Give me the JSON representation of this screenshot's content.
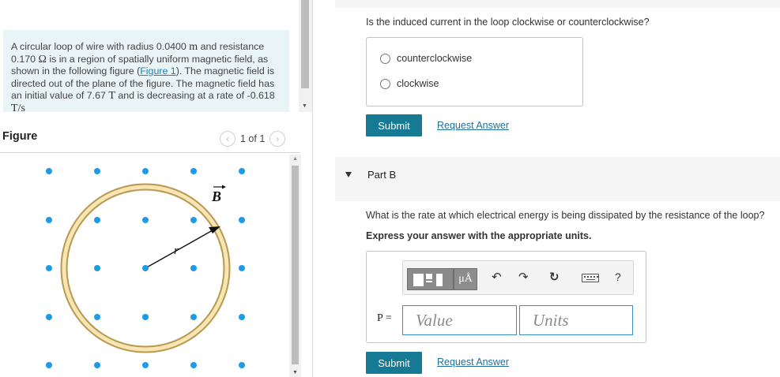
{
  "problem": {
    "text_1": "A circular loop of wire with radius 0.0400",
    "unit_m": "m",
    "text_2": "and resistance 0.170",
    "unit_ohm": "Ω",
    "text_3": "is in a region of spatially uniform magnetic field, as shown in the following figure (",
    "figure_link": "Figure 1",
    "text_4": "). The magnetic field is directed out of the plane of the figure. The magnetic field has an initial value of 7.67",
    "unit_T": "T",
    "text_5": "and is decreasing at a rate of -0.618",
    "unit_Ts": "T/s"
  },
  "figure": {
    "title": "Figure",
    "pager_text": "1 of 1",
    "prev_glyph": "‹",
    "next_glyph": "›",
    "b_label": "B",
    "r_label": "r",
    "colors": {
      "dot": "#1e9be6",
      "ring_outer": "#b99950",
      "ring_fill": "#f7e6b4",
      "arrow": "#111111"
    }
  },
  "part_a": {
    "question": "Is the induced current in the loop clockwise or counterclockwise?",
    "options": [
      "counterclockwise",
      "clockwise"
    ],
    "submit_label": "Submit",
    "request_label": "Request Answer"
  },
  "part_b": {
    "title": "Part B",
    "question": "What is the rate at which electrical energy is being dissipated by the resistance of the loop?",
    "instruction": "Express your answer with the appropriate units.",
    "toolbar": {
      "mu_label": "μÅ",
      "undo_glyph": "↶",
      "redo_glyph": "↷",
      "reset_glyph": "↻",
      "help_label": "?",
      "icons": [
        "templates-icon",
        "units-icon",
        "undo-icon",
        "redo-icon",
        "reset-icon",
        "keyboard-icon",
        "help-icon"
      ]
    },
    "var_label": "P =",
    "value_placeholder": "Value",
    "units_placeholder": "Units",
    "submit_label": "Submit",
    "request_label": "Request Answer"
  },
  "colors": {
    "accent": "#167a94",
    "link": "#1f6f9a",
    "problem_bg": "#e8f4f6"
  }
}
